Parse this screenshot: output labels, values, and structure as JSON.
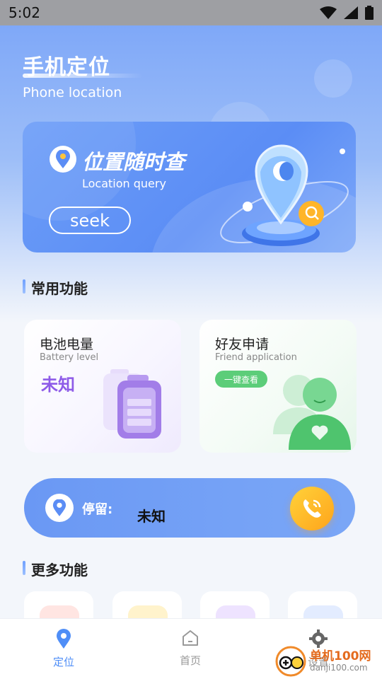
{
  "status_bar": {
    "time": "5:02"
  },
  "header": {
    "title": "手机定位",
    "subtitle": "Phone location"
  },
  "query_card": {
    "title": "位置随时查",
    "subtitle": "Location query",
    "button_label": "seek"
  },
  "common_section": {
    "title": "常用功能"
  },
  "battery_card": {
    "title": "电池电量",
    "subtitle": "Battery level",
    "value": "未知"
  },
  "friend_card": {
    "title": "好友申请",
    "subtitle": "Friend application",
    "button_label": "一键查看"
  },
  "stay_bar": {
    "label": "停留:",
    "value": "未知"
  },
  "more_section": {
    "title": "更多功能"
  },
  "more_items": [
    {
      "icon": "red-icon",
      "color": "#ffe5e2"
    },
    {
      "icon": "yellow-icon",
      "color": "#fff3cc"
    },
    {
      "icon": "purple-icon",
      "color": "#eee3ff"
    },
    {
      "icon": "blue-icon",
      "color": "#e3ecff"
    }
  ],
  "bottom_nav": {
    "items": [
      {
        "label": "定位",
        "icon": "location-pin-icon",
        "active": true
      },
      {
        "label": "首页",
        "icon": "home-icon",
        "active": false
      },
      {
        "label": "设置",
        "icon": "gear-icon",
        "active": false
      }
    ]
  },
  "watermark": {
    "name": "单机100网",
    "url": "danji100.com"
  },
  "colors": {
    "accent": "#5b8df5",
    "battery_value": "#8e5be8",
    "friend_button": "#5ccd79",
    "call_button": "#ffb52a"
  }
}
